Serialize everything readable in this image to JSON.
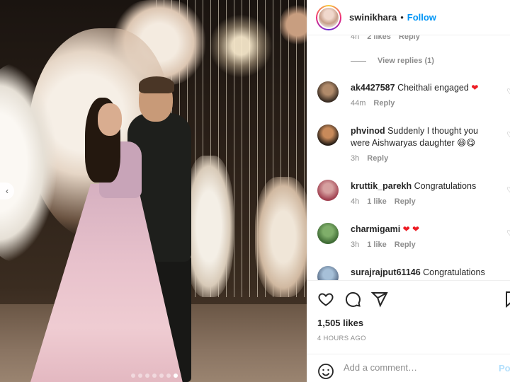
{
  "header": {
    "username": "swinikhara",
    "separator": "•",
    "follow_label": "Follow"
  },
  "thread_top": {
    "time": "4h",
    "likes": "2 likes",
    "reply": "Reply",
    "view_replies": "View replies (1)"
  },
  "comments": [
    {
      "username": "ak4427587",
      "text": "Cheithali engaged",
      "emoji": "❤",
      "time": "44m",
      "likes": "",
      "reply": "Reply"
    },
    {
      "username": "phvinod",
      "text": "Suddenly I thought you were Aishwaryas daughter",
      "emoji": "😄😋",
      "time": "3h",
      "likes": "",
      "reply": "Reply"
    },
    {
      "username": "kruttik_parekh",
      "text": "Congratulations",
      "emoji": "",
      "time": "4h",
      "likes": "1 like",
      "reply": "Reply"
    },
    {
      "username": "charmigami",
      "text": "",
      "emoji": "❤ ❤",
      "time": "3h",
      "likes": "1 like",
      "reply": "Reply"
    },
    {
      "username": "surajrajput61146",
      "text": "Congratulations",
      "emoji": "",
      "time": "",
      "likes": "",
      "reply": ""
    }
  ],
  "actions": {
    "likes_count": "1,505 likes",
    "timestamp": "4 HOURS AGO"
  },
  "add_comment": {
    "placeholder": "Add a comment…",
    "post_label": "Post"
  },
  "colors": {
    "accent": "#0095f6",
    "muted_text": "#8e8e8e",
    "heart": "#ed1c24"
  },
  "carousel": {
    "slides": 7,
    "active": 7
  }
}
